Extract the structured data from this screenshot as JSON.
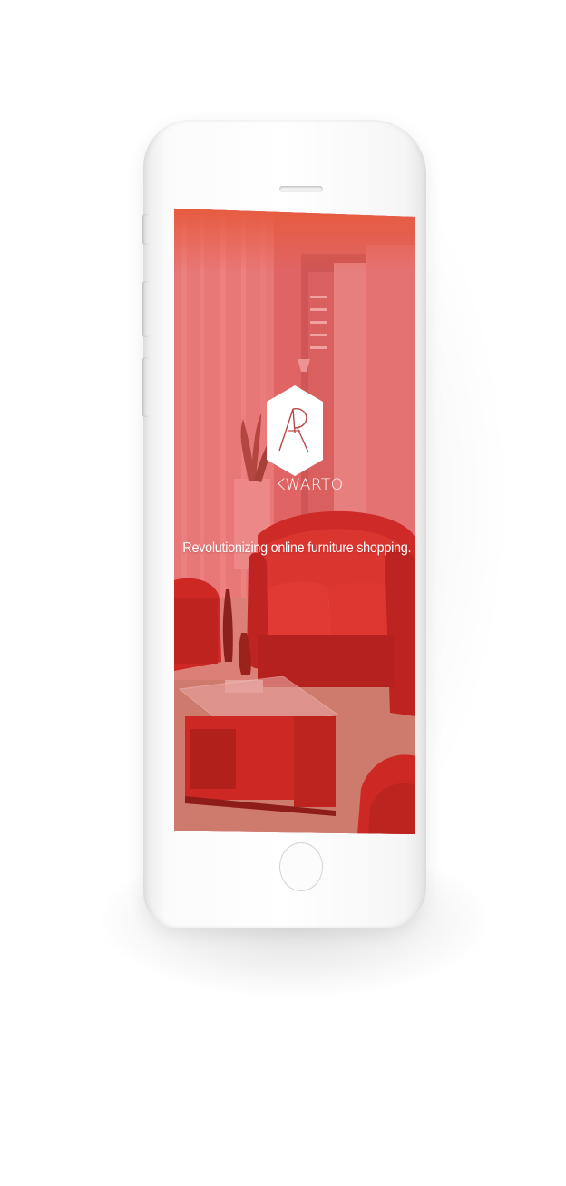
{
  "app": {
    "brand_name": "KWARTO",
    "tagline": "Revolutionizing online furniture shopping.",
    "logo_letters": "AR"
  },
  "colors": {
    "overlay_red": "#d8463f",
    "sofa_red": "#c8201c",
    "logo_white": "#ffffff"
  },
  "icons": {
    "logo": "hexagon-ar-monogram"
  }
}
